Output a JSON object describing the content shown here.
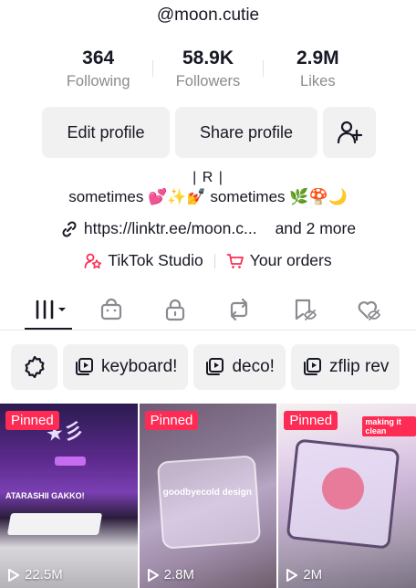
{
  "profile": {
    "username": "@moon.cutie"
  },
  "stats": [
    {
      "value": "364",
      "label": "Following"
    },
    {
      "value": "58.9K",
      "label": "Followers"
    },
    {
      "value": "2.9M",
      "label": "Likes"
    }
  ],
  "actions": {
    "edit_label": "Edit profile",
    "share_label": "Share profile"
  },
  "bio": {
    "line1": "| R |",
    "line2_a": "sometimes",
    "line2_emoji_a": "💕✨💅",
    "line2_b": "sometimes",
    "line2_emoji_b": "🌿🍄🌙"
  },
  "link": {
    "url": "https://linktr.ee/moon.c...",
    "more": "and 2 more"
  },
  "shortcuts": {
    "studio": "TikTok Studio",
    "orders": "Your orders"
  },
  "tabs": [
    "videos",
    "shop",
    "private",
    "reposts",
    "favorites",
    "liked"
  ],
  "playlists": [
    {
      "label": "keyboard!"
    },
    {
      "label": "deco!"
    },
    {
      "label": "zflip rev"
    }
  ],
  "videos": [
    {
      "badge": "Pinned",
      "views": "22.5M",
      "overlay": "ATARASHII GAKKO!"
    },
    {
      "badge": "Pinned",
      "views": "2.8M",
      "overlay": "goodbyecold design"
    },
    {
      "badge": "Pinned",
      "views": "2M",
      "overlay": "making it clean"
    }
  ],
  "colors": {
    "accent": "#fe2c55",
    "text": "#161823",
    "muted": "#8a8b91",
    "button_bg": "#f1f1f2"
  }
}
